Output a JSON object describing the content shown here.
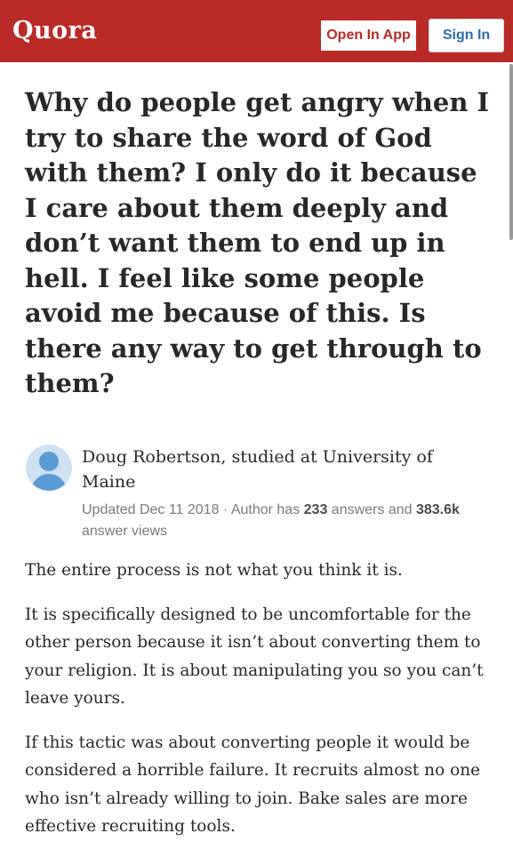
{
  "header": {
    "logo": "Quora",
    "open_in_app": "Open In App",
    "sign_in": "Sign In"
  },
  "question": {
    "title": "Why do people get angry when I try to share the word of God with them? I only do it because I care about them deeply and don’t want them to end up in hell. I feel like some people avoid me because of this. Is there any way to get through to them?"
  },
  "author": {
    "name_credential": "Doug Robertson, studied at University of Maine",
    "updated": "Updated Dec 11 2018 · Author has ",
    "answers_count": "233",
    "answers_label": " answers and ",
    "views_count": "383.6k",
    "views_label": " answer views"
  },
  "answer": {
    "paragraphs": [
      "The entire process is not what you think it is.",
      "It is specifically designed to be uncomfortable for the other person because it isn’t about converting them to your religion. It is about manipulating you so you can’t leave yours.",
      "If this tactic was about converting people it would be considered a horrible failure. It recruits almost no one who isn’t already willing to join. Bake sales are more effective recruiting tools."
    ]
  },
  "colors": {
    "brand": "#b92b27",
    "link": "#2b6dad",
    "text": "#282829",
    "meta": "#7a7a7a",
    "avatar": "#5b9bd5"
  },
  "icons": {
    "avatar": "default-user-avatar-icon"
  }
}
